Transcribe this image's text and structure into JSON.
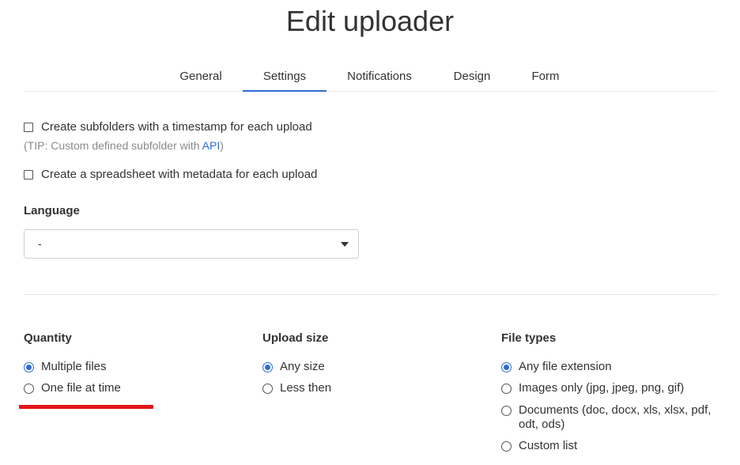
{
  "page": {
    "title": "Edit uploader"
  },
  "tabs": [
    {
      "label": "General"
    },
    {
      "label": "Settings",
      "active": true
    },
    {
      "label": "Notifications"
    },
    {
      "label": "Design"
    },
    {
      "label": "Form"
    }
  ],
  "settings": {
    "subfolders_label": "Create subfolders with a timestamp for each upload",
    "tip_prefix": "(TIP: Custom defined subfolder with ",
    "tip_link": "API",
    "tip_suffix": ")",
    "spreadsheet_label": "Create a spreadsheet with metadata for each upload"
  },
  "language": {
    "label": "Language",
    "selected": "-"
  },
  "quantity": {
    "heading": "Quantity",
    "options": [
      {
        "label": "Multiple files",
        "selected": true
      },
      {
        "label": "One file at time",
        "selected": false
      }
    ]
  },
  "upload_size": {
    "heading": "Upload size",
    "options": [
      {
        "label": "Any size",
        "selected": true
      },
      {
        "label": "Less then",
        "selected": false
      }
    ]
  },
  "file_types": {
    "heading": "File types",
    "options": [
      {
        "label": "Any file extension",
        "selected": true
      },
      {
        "label": "Images only (jpg, jpeg, png, gif)",
        "selected": false
      },
      {
        "label": "Documents (doc, docx, xls, xlsx, pdf, odt, ods)",
        "selected": false
      },
      {
        "label": "Custom list",
        "selected": false
      }
    ]
  },
  "colors": {
    "accent": "#2e6bd6",
    "annotation": "#e3151a"
  }
}
